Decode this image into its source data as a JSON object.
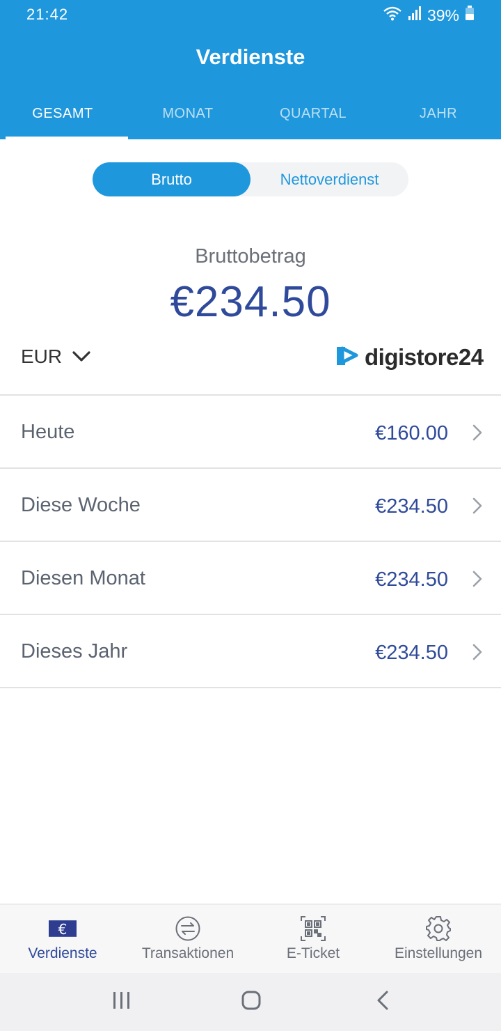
{
  "status_bar": {
    "time": "21:42",
    "battery": "39%"
  },
  "app": {
    "title": "Verdienste"
  },
  "tabs": [
    {
      "label": "GESAMT",
      "active": true
    },
    {
      "label": "MONAT",
      "active": false
    },
    {
      "label": "QUARTAL",
      "active": false
    },
    {
      "label": "JAHR",
      "active": false
    }
  ],
  "toggle": {
    "gross_label": "Brutto",
    "net_label": "Nettoverdienst",
    "selected": "Brutto"
  },
  "summary": {
    "label": "Bruttobetrag",
    "amount": "€234.50"
  },
  "currency": {
    "value": "EUR"
  },
  "brand": {
    "logo_text": "digistore24"
  },
  "earnings": [
    {
      "label": "Heute",
      "value": "€160.00"
    },
    {
      "label": "Diese Woche",
      "value": "€234.50"
    },
    {
      "label": "Diesen Monat",
      "value": "€234.50"
    },
    {
      "label": "Dieses Jahr",
      "value": "€234.50"
    }
  ],
  "bottom_nav": [
    {
      "label": "Verdienste",
      "icon": "euro-icon",
      "active": true
    },
    {
      "label": "Transaktionen",
      "icon": "exchange-icon",
      "active": false
    },
    {
      "label": "E-Ticket",
      "icon": "qr-code-icon",
      "active": false
    },
    {
      "label": "Einstellungen",
      "icon": "gear-icon",
      "active": false
    }
  ],
  "colors": {
    "primary": "#1f97dc",
    "amount": "#2f4a9a",
    "text_muted": "#5b6370"
  }
}
